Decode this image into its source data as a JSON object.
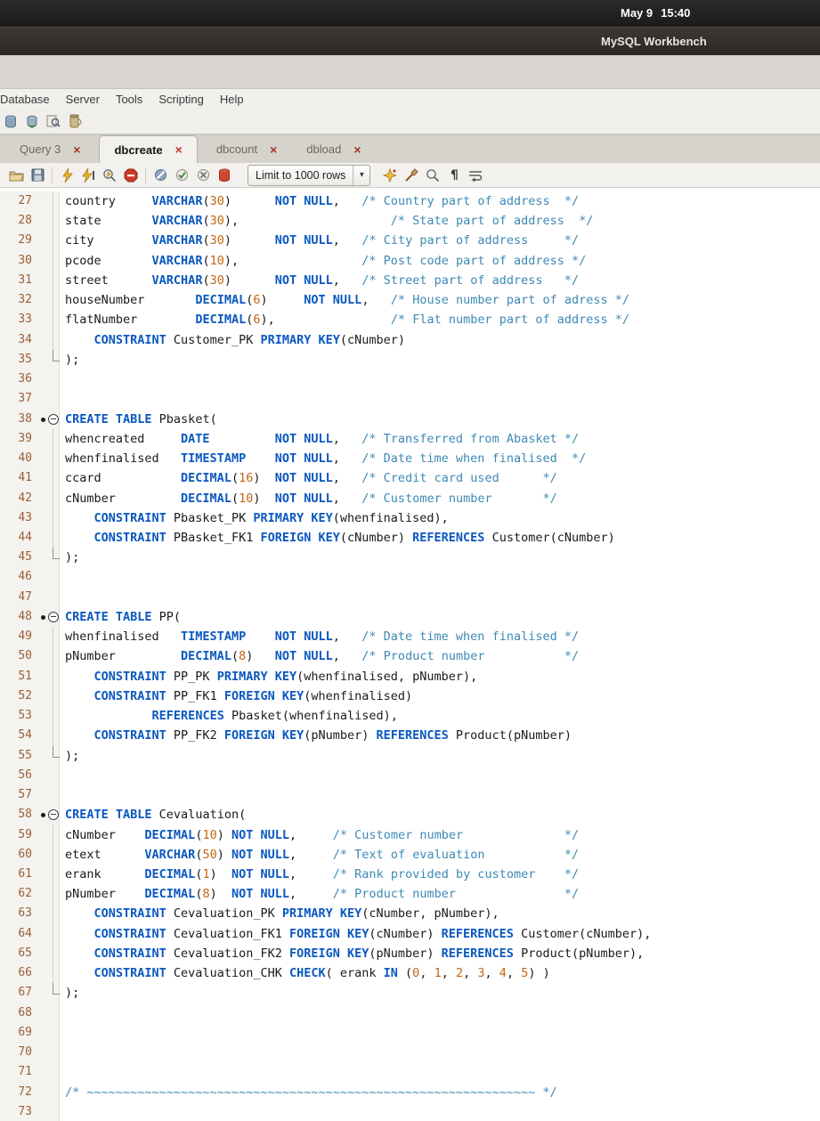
{
  "system_bar": {
    "date": "May 9",
    "time": "15:40"
  },
  "title_bar": {
    "title": "MySQL Workbench"
  },
  "menu_bar": {
    "items": [
      "Database",
      "Server",
      "Tools",
      "Scripting",
      "Help"
    ]
  },
  "main_toolbar": {
    "icons": [
      "database-icon",
      "sync-database-icon",
      "search-database-icon",
      "dump-icon"
    ]
  },
  "query_tabs": [
    {
      "label": "Query 3",
      "active": false
    },
    {
      "label": "dbcreate",
      "active": true
    },
    {
      "label": "dbcount",
      "active": false
    },
    {
      "label": "dbload",
      "active": false
    }
  ],
  "editor_toolbar": {
    "limit_label": "Limit to 1000 rows",
    "icons": [
      "open-file-icon",
      "save-icon",
      "execute-script-icon",
      "execute-statement-icon",
      "explain-icon",
      "stop-icon",
      "toggle-stop-on-error-icon",
      "commit-icon",
      "rollback-icon",
      "autocommit-icon",
      "beautify-icon",
      "clear-icon",
      "find-icon",
      "invisibles-icon",
      "wrap-icon"
    ]
  },
  "editor": {
    "first_line": 27,
    "last_line": 73,
    "lines": [
      {
        "n": 27,
        "m": "mid",
        "s": [
          [
            "t",
            "country     "
          ],
          [
            "k",
            "VARCHAR"
          ],
          [
            "t",
            "("
          ],
          [
            "n",
            "30"
          ],
          [
            "t",
            ")      "
          ],
          [
            "k",
            "NOT NULL"
          ],
          [
            "t",
            ",   "
          ],
          [
            "c",
            "/* Country part of address  */"
          ]
        ]
      },
      {
        "n": 28,
        "m": "mid",
        "s": [
          [
            "t",
            "state       "
          ],
          [
            "k",
            "VARCHAR"
          ],
          [
            "t",
            "("
          ],
          [
            "n",
            "30"
          ],
          [
            "t",
            "),                     "
          ],
          [
            "c",
            "/* State part of address  */"
          ]
        ]
      },
      {
        "n": 29,
        "m": "mid",
        "s": [
          [
            "t",
            "city        "
          ],
          [
            "k",
            "VARCHAR"
          ],
          [
            "t",
            "("
          ],
          [
            "n",
            "30"
          ],
          [
            "t",
            ")      "
          ],
          [
            "k",
            "NOT NULL"
          ],
          [
            "t",
            ",   "
          ],
          [
            "c",
            "/* City part of address     */"
          ]
        ]
      },
      {
        "n": 30,
        "m": "mid",
        "s": [
          [
            "t",
            "pcode       "
          ],
          [
            "k",
            "VARCHAR"
          ],
          [
            "t",
            "("
          ],
          [
            "n",
            "10"
          ],
          [
            "t",
            "),                 "
          ],
          [
            "c",
            "/* Post code part of address */"
          ]
        ]
      },
      {
        "n": 31,
        "m": "mid",
        "s": [
          [
            "t",
            "street      "
          ],
          [
            "k",
            "VARCHAR"
          ],
          [
            "t",
            "("
          ],
          [
            "n",
            "30"
          ],
          [
            "t",
            ")      "
          ],
          [
            "k",
            "NOT NULL"
          ],
          [
            "t",
            ",   "
          ],
          [
            "c",
            "/* Street part of address   */"
          ]
        ]
      },
      {
        "n": 32,
        "m": "mid",
        "s": [
          [
            "t",
            "houseNumber       "
          ],
          [
            "k",
            "DECIMAL"
          ],
          [
            "t",
            "("
          ],
          [
            "n",
            "6"
          ],
          [
            "t",
            ")     "
          ],
          [
            "k",
            "NOT NULL"
          ],
          [
            "t",
            ",   "
          ],
          [
            "c",
            "/* House number part of adress */"
          ]
        ]
      },
      {
        "n": 33,
        "m": "mid",
        "s": [
          [
            "t",
            "flatNumber        "
          ],
          [
            "k",
            "DECIMAL"
          ],
          [
            "t",
            "("
          ],
          [
            "n",
            "6"
          ],
          [
            "t",
            "),                "
          ],
          [
            "c",
            "/* Flat number part of address */"
          ]
        ]
      },
      {
        "n": 34,
        "m": "mid",
        "s": [
          [
            "t",
            "    "
          ],
          [
            "k",
            "CONSTRAINT"
          ],
          [
            "t",
            " Customer_PK "
          ],
          [
            "k",
            "PRIMARY KEY"
          ],
          [
            "t",
            "(cNumber)"
          ]
        ]
      },
      {
        "n": 35,
        "m": "close",
        "s": [
          [
            "t",
            ");"
          ]
        ]
      },
      {
        "n": 36,
        "m": "",
        "s": []
      },
      {
        "n": 37,
        "m": "",
        "s": []
      },
      {
        "n": 38,
        "m": "open",
        "s": [
          [
            "k",
            "CREATE TABLE"
          ],
          [
            "t",
            " Pbasket("
          ]
        ]
      },
      {
        "n": 39,
        "m": "mid",
        "s": [
          [
            "t",
            "whencreated     "
          ],
          [
            "k",
            "DATE"
          ],
          [
            "t",
            "         "
          ],
          [
            "k",
            "NOT NULL"
          ],
          [
            "t",
            ",   "
          ],
          [
            "c",
            "/* Transferred from Abasket */"
          ]
        ]
      },
      {
        "n": 40,
        "m": "mid",
        "s": [
          [
            "t",
            "whenfinalised   "
          ],
          [
            "k",
            "TIMESTAMP"
          ],
          [
            "t",
            "    "
          ],
          [
            "k",
            "NOT NULL"
          ],
          [
            "t",
            ",   "
          ],
          [
            "c",
            "/* Date time when finalised  */"
          ]
        ]
      },
      {
        "n": 41,
        "m": "mid",
        "s": [
          [
            "t",
            "ccard           "
          ],
          [
            "k",
            "DECIMAL"
          ],
          [
            "t",
            "("
          ],
          [
            "n",
            "16"
          ],
          [
            "t",
            ")  "
          ],
          [
            "k",
            "NOT NULL"
          ],
          [
            "t",
            ",   "
          ],
          [
            "c",
            "/* Credit card used      */"
          ]
        ]
      },
      {
        "n": 42,
        "m": "mid",
        "s": [
          [
            "t",
            "cNumber         "
          ],
          [
            "k",
            "DECIMAL"
          ],
          [
            "t",
            "("
          ],
          [
            "n",
            "10"
          ],
          [
            "t",
            ")  "
          ],
          [
            "k",
            "NOT NULL"
          ],
          [
            "t",
            ",   "
          ],
          [
            "c",
            "/* Customer number       */"
          ]
        ]
      },
      {
        "n": 43,
        "m": "mid",
        "s": [
          [
            "t",
            "    "
          ],
          [
            "k",
            "CONSTRAINT"
          ],
          [
            "t",
            " Pbasket_PK "
          ],
          [
            "k",
            "PRIMARY KEY"
          ],
          [
            "t",
            "(whenfinalised),"
          ]
        ]
      },
      {
        "n": 44,
        "m": "mid",
        "s": [
          [
            "t",
            "    "
          ],
          [
            "k",
            "CONSTRAINT"
          ],
          [
            "t",
            " PBasket_FK1 "
          ],
          [
            "k",
            "FOREIGN KEY"
          ],
          [
            "t",
            "(cNumber) "
          ],
          [
            "k",
            "REFERENCES"
          ],
          [
            "t",
            " Customer(cNumber)"
          ]
        ]
      },
      {
        "n": 45,
        "m": "close",
        "s": [
          [
            "t",
            ");"
          ]
        ]
      },
      {
        "n": 46,
        "m": "",
        "s": []
      },
      {
        "n": 47,
        "m": "",
        "s": []
      },
      {
        "n": 48,
        "m": "open",
        "s": [
          [
            "k",
            "CREATE TABLE"
          ],
          [
            "t",
            " PP("
          ]
        ]
      },
      {
        "n": 49,
        "m": "mid",
        "s": [
          [
            "t",
            "whenfinalised   "
          ],
          [
            "k",
            "TIMESTAMP"
          ],
          [
            "t",
            "    "
          ],
          [
            "k",
            "NOT NULL"
          ],
          [
            "t",
            ",   "
          ],
          [
            "c",
            "/* Date time when finalised */"
          ]
        ]
      },
      {
        "n": 50,
        "m": "mid",
        "s": [
          [
            "t",
            "pNumber         "
          ],
          [
            "k",
            "DECIMAL"
          ],
          [
            "t",
            "("
          ],
          [
            "n",
            "8"
          ],
          [
            "t",
            ")   "
          ],
          [
            "k",
            "NOT NULL"
          ],
          [
            "t",
            ",   "
          ],
          [
            "c",
            "/* Product number           */"
          ]
        ]
      },
      {
        "n": 51,
        "m": "mid",
        "s": [
          [
            "t",
            "    "
          ],
          [
            "k",
            "CONSTRAINT"
          ],
          [
            "t",
            " PP_PK "
          ],
          [
            "k",
            "PRIMARY KEY"
          ],
          [
            "t",
            "(whenfinalised, pNumber),"
          ]
        ]
      },
      {
        "n": 52,
        "m": "mid",
        "s": [
          [
            "t",
            "    "
          ],
          [
            "k",
            "CONSTRAINT"
          ],
          [
            "t",
            " PP_FK1 "
          ],
          [
            "k",
            "FOREIGN KEY"
          ],
          [
            "t",
            "(whenfinalised)"
          ]
        ]
      },
      {
        "n": 53,
        "m": "mid",
        "s": [
          [
            "t",
            "            "
          ],
          [
            "k",
            "REFERENCES"
          ],
          [
            "t",
            " Pbasket(whenfinalised),"
          ]
        ]
      },
      {
        "n": 54,
        "m": "mid",
        "s": [
          [
            "t",
            "    "
          ],
          [
            "k",
            "CONSTRAINT"
          ],
          [
            "t",
            " PP_FK2 "
          ],
          [
            "k",
            "FOREIGN KEY"
          ],
          [
            "t",
            "(pNumber) "
          ],
          [
            "k",
            "REFERENCES"
          ],
          [
            "t",
            " Product(pNumber)"
          ]
        ]
      },
      {
        "n": 55,
        "m": "close",
        "s": [
          [
            "t",
            ");"
          ]
        ]
      },
      {
        "n": 56,
        "m": "",
        "s": []
      },
      {
        "n": 57,
        "m": "",
        "s": []
      },
      {
        "n": 58,
        "m": "open",
        "s": [
          [
            "k",
            "CREATE TABLE"
          ],
          [
            "t",
            " Cevaluation("
          ]
        ]
      },
      {
        "n": 59,
        "m": "mid",
        "s": [
          [
            "t",
            "cNumber    "
          ],
          [
            "k",
            "DECIMAL"
          ],
          [
            "t",
            "("
          ],
          [
            "n",
            "10"
          ],
          [
            "t",
            ") "
          ],
          [
            "k",
            "NOT NULL"
          ],
          [
            "t",
            ",     "
          ],
          [
            "c",
            "/* Customer number              */"
          ]
        ]
      },
      {
        "n": 60,
        "m": "mid",
        "s": [
          [
            "t",
            "etext      "
          ],
          [
            "k",
            "VARCHAR"
          ],
          [
            "t",
            "("
          ],
          [
            "n",
            "50"
          ],
          [
            "t",
            ") "
          ],
          [
            "k",
            "NOT NULL"
          ],
          [
            "t",
            ",     "
          ],
          [
            "c",
            "/* Text of evaluation           */"
          ]
        ]
      },
      {
        "n": 61,
        "m": "mid",
        "s": [
          [
            "t",
            "erank      "
          ],
          [
            "k",
            "DECIMAL"
          ],
          [
            "t",
            "("
          ],
          [
            "n",
            "1"
          ],
          [
            "t",
            ")  "
          ],
          [
            "k",
            "NOT NULL"
          ],
          [
            "t",
            ",     "
          ],
          [
            "c",
            "/* Rank provided by customer    */"
          ]
        ]
      },
      {
        "n": 62,
        "m": "mid",
        "s": [
          [
            "t",
            "pNumber    "
          ],
          [
            "k",
            "DECIMAL"
          ],
          [
            "t",
            "("
          ],
          [
            "n",
            "8"
          ],
          [
            "t",
            ")  "
          ],
          [
            "k",
            "NOT NULL"
          ],
          [
            "t",
            ",     "
          ],
          [
            "c",
            "/* Product number               */"
          ]
        ]
      },
      {
        "n": 63,
        "m": "mid",
        "s": [
          [
            "t",
            "    "
          ],
          [
            "k",
            "CONSTRAINT"
          ],
          [
            "t",
            " Cevaluation_PK "
          ],
          [
            "k",
            "PRIMARY KEY"
          ],
          [
            "t",
            "(cNumber, pNumber),"
          ]
        ]
      },
      {
        "n": 64,
        "m": "mid",
        "s": [
          [
            "t",
            "    "
          ],
          [
            "k",
            "CONSTRAINT"
          ],
          [
            "t",
            " Cevaluation_FK1 "
          ],
          [
            "k",
            "FOREIGN KEY"
          ],
          [
            "t",
            "(cNumber) "
          ],
          [
            "k",
            "REFERENCES"
          ],
          [
            "t",
            " Customer(cNumber),"
          ]
        ]
      },
      {
        "n": 65,
        "m": "mid",
        "s": [
          [
            "t",
            "    "
          ],
          [
            "k",
            "CONSTRAINT"
          ],
          [
            "t",
            " Cevaluation_FK2 "
          ],
          [
            "k",
            "FOREIGN KEY"
          ],
          [
            "t",
            "(pNumber) "
          ],
          [
            "k",
            "REFERENCES"
          ],
          [
            "t",
            " Product(pNumber),"
          ]
        ]
      },
      {
        "n": 66,
        "m": "mid",
        "s": [
          [
            "t",
            "    "
          ],
          [
            "k",
            "CONSTRAINT"
          ],
          [
            "t",
            " Cevaluation_CHK "
          ],
          [
            "k",
            "CHECK"
          ],
          [
            "t",
            "( erank "
          ],
          [
            "k",
            "IN"
          ],
          [
            "t",
            " ("
          ],
          [
            "n",
            "0"
          ],
          [
            "t",
            ", "
          ],
          [
            "n",
            "1"
          ],
          [
            "t",
            ", "
          ],
          [
            "n",
            "2"
          ],
          [
            "t",
            ", "
          ],
          [
            "n",
            "3"
          ],
          [
            "t",
            ", "
          ],
          [
            "n",
            "4"
          ],
          [
            "t",
            ", "
          ],
          [
            "n",
            "5"
          ],
          [
            "t",
            ") )"
          ]
        ]
      },
      {
        "n": 67,
        "m": "close",
        "s": [
          [
            "t",
            ");"
          ]
        ]
      },
      {
        "n": 68,
        "m": "",
        "s": []
      },
      {
        "n": 69,
        "m": "",
        "s": []
      },
      {
        "n": 70,
        "m": "",
        "s": []
      },
      {
        "n": 71,
        "m": "",
        "s": []
      },
      {
        "n": 72,
        "m": "",
        "s": [
          [
            "c",
            "/* ~~~~~~~~~~~~~~~~~~~~~~~~~~~~~~~~~~~~~~~~~~~~~~~~~~~~~~~~~~~~~~ */"
          ]
        ]
      },
      {
        "n": 73,
        "m": "",
        "s": []
      }
    ]
  }
}
